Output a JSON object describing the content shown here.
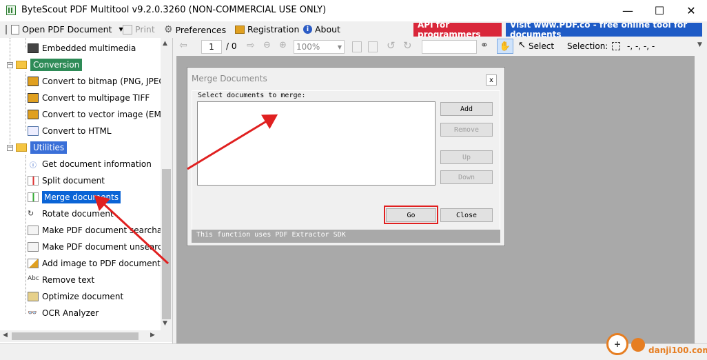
{
  "window": {
    "title": "ByteScout PDF Multitool v9.2.0.3260 (NON-COMMERCIAL USE ONLY)",
    "minimize": "—",
    "maximize": "☐",
    "close": "✕"
  },
  "menu": {
    "open": "Open PDF Document",
    "print": "Print",
    "preferences": "Preferences",
    "registration": "Registration",
    "about": "About",
    "api": "API for programmers",
    "visit": "Visit www.PDF.co - free online tool for documents"
  },
  "sidebar": {
    "items": [
      {
        "label": "Embedded multimedia",
        "kind": "item"
      },
      {
        "label": "Conversion",
        "kind": "category",
        "color": "#2e8b57"
      },
      {
        "label": "Convert to bitmap (PNG, JPEG, ...",
        "kind": "item"
      },
      {
        "label": "Convert to multipage TIFF",
        "kind": "item"
      },
      {
        "label": "Convert to vector image (EMF)",
        "kind": "item"
      },
      {
        "label": "Convert to HTML",
        "kind": "item"
      },
      {
        "label": "Utilities",
        "kind": "category",
        "color": "#3a6fd8"
      },
      {
        "label": "Get document information",
        "kind": "item"
      },
      {
        "label": "Split document",
        "kind": "item"
      },
      {
        "label": "Merge documents",
        "kind": "item",
        "selected": true
      },
      {
        "label": "Rotate document",
        "kind": "item"
      },
      {
        "label": "Make PDF document searchable",
        "kind": "item"
      },
      {
        "label": "Make PDF document unsearchable",
        "kind": "item"
      },
      {
        "label": "Add image to PDF document",
        "kind": "item"
      },
      {
        "label": "Remove text",
        "kind": "item"
      },
      {
        "label": "Optimize document",
        "kind": "item"
      },
      {
        "label": "OCR Analyzer",
        "kind": "item"
      }
    ]
  },
  "toolbar": {
    "page_number": "1",
    "page_total": "/ 0",
    "zoom": "100%",
    "select": "Select",
    "selection_label": "Selection:",
    "selection_value": "-, -, -, -"
  },
  "dialog": {
    "title": "Merge Documents",
    "close": "x",
    "prompt": "Select documents to merge:",
    "add": "Add",
    "remove": "Remove",
    "up": "Up",
    "down": "Down",
    "go": "Go",
    "close_btn": "Close",
    "footer": "This function uses PDF Extractor SDK"
  },
  "colors": {
    "selected": "#0a64d6",
    "highlight": "#e02020",
    "api": "#d9273a",
    "visit": "#1e5bc6"
  },
  "watermark": {
    "text": "danji100.com"
  }
}
